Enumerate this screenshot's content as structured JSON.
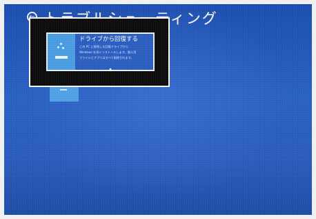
{
  "header": {
    "title": "トラブルシューティング",
    "back_icon": "back-arrow-icon",
    "back_glyph": "←"
  },
  "option": {
    "title": "ドライブから回復する",
    "description": [
      "この PC に接続した回復ドライブから",
      "Windows を再インストールします。個人用",
      "ファイルとアプリはすべて削除されます。"
    ],
    "icon": "recovery-drive-icon"
  },
  "colors": {
    "background": "#1f53b4",
    "tile": "#2b5fc2",
    "icon_bg": "#4a9fe4",
    "highlight_border": "#ffffff"
  }
}
